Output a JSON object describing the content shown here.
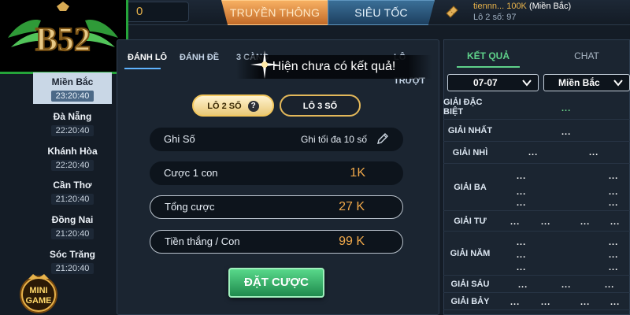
{
  "header": {
    "balance": "0",
    "tab_truyen_thong": "TRUYỀN THÔNG",
    "tab_sieu_toc": "SIÊU TỐC",
    "user_name": "tiennn...",
    "user_amount": "100K",
    "user_region": "(Miền Bắc)",
    "user_line2": "Lô 2 số: 97"
  },
  "logo": {
    "text": "B52"
  },
  "provinces": [
    {
      "name": "Miền Bắc",
      "time": "23:20:40"
    },
    {
      "name": "Đà Nẵng",
      "time": "22:20:40"
    },
    {
      "name": "Khánh Hòa",
      "time": "22:20:40"
    },
    {
      "name": "Cần Thơ",
      "time": "21:20:40"
    },
    {
      "name": "Đồng Nai",
      "time": "21:20:40"
    },
    {
      "name": "Sóc Trăng",
      "time": "21:20:40"
    }
  ],
  "minigame": {
    "line1": "MINI",
    "line2": "GAME"
  },
  "game_tabs": [
    "ĐÁNH LÔ",
    "ĐÁNH ĐỀ",
    "3 CÀNG",
    "LÔ TRƯỢT"
  ],
  "toast": "Hiện chưa có kết quả!",
  "modes": {
    "lo2": "LÔ 2 SỐ",
    "lo3": "LÔ 3 SỐ",
    "help": "?"
  },
  "form": {
    "ghi_so_label": "Ghi Số",
    "ghi_so_placeholder": "Ghi tối đa 10 số",
    "cuoc_label": "Cược 1 con",
    "cuoc_value": "1K",
    "tong_label": "Tổng cược",
    "tong_value": "27 K",
    "thang_label": "Tiền thắng / Con",
    "thang_value": "99 K"
  },
  "bet_button": "ĐẶT CƯỢC",
  "results": {
    "tab_ket_qua": "KẾT QUẢ",
    "tab_chat": "CHAT",
    "date": "07-07",
    "region": "Miền Bắc",
    "prizes": [
      {
        "label": "GIẢI ĐẶC BIỆT",
        "values": [
          "..."
        ]
      },
      {
        "label": "GIẢI NHẤT",
        "values": [
          "..."
        ]
      },
      {
        "label": "GIẢI NHÌ",
        "values": [
          "...",
          "..."
        ]
      },
      {
        "label": "GIẢI BA",
        "values": [
          "...",
          "...",
          "...",
          "...",
          "...",
          "..."
        ]
      },
      {
        "label": "GIẢI TƯ",
        "values": [
          "...",
          "...",
          "...",
          "..."
        ]
      },
      {
        "label": "GIẢI NĂM",
        "values": [
          "...",
          "...",
          "...",
          "...",
          "...",
          "..."
        ]
      },
      {
        "label": "GIẢI SÁU",
        "values": [
          "...",
          "...",
          "..."
        ]
      },
      {
        "label": "GIẢI BẢY",
        "values": [
          "...",
          "...",
          "...",
          "..."
        ]
      }
    ]
  }
}
